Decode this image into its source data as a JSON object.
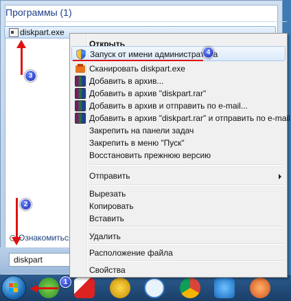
{
  "start_menu": {
    "section_title": "Программы (1)",
    "result_label": "diskpart.exe",
    "see_more": "Ознакомиться с",
    "search_value": "diskpart"
  },
  "context_menu": {
    "open": "Открыть",
    "run_as_admin": "Запуск от имени администратора",
    "scan": "Сканировать diskpart.exe",
    "add_archive": "Добавить в архив...",
    "add_rar": "Добавить в архив \"diskpart.rar\"",
    "add_email": "Добавить в архив и отправить по e-mail...",
    "add_rar_email": "Добавить в архив \"diskpart.rar\" и отправить по e-mail",
    "pin_taskbar": "Закрепить на панели задач",
    "pin_start": "Закрепить в меню \"Пуск\"",
    "restore": "Восстановить прежнюю версию",
    "send_to": "Отправить",
    "cut": "Вырезать",
    "copy": "Копировать",
    "paste": "Вставить",
    "delete": "Удалить",
    "file_location": "Расположение файла",
    "properties": "Свойства"
  },
  "badges": {
    "b1": "1",
    "b2": "2",
    "b3": "3",
    "b4": "4"
  },
  "icons": {
    "shield": "uac-shield-icon",
    "scan": "antivirus-scan-icon",
    "rar": "winrar-icon",
    "start": "windows-start-icon"
  },
  "colors": {
    "annotation": "#dd1111",
    "badge": "#1b2fb4",
    "menu_bg": "#f0f0f0"
  }
}
